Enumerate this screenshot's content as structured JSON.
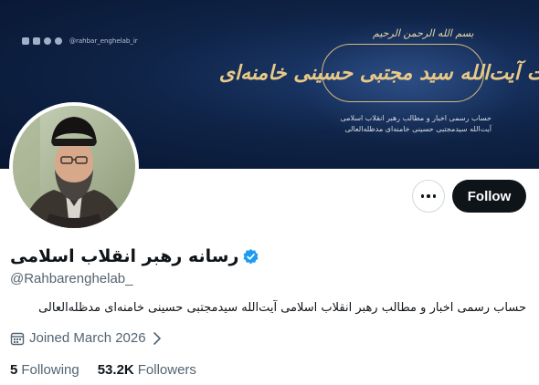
{
  "banner": {
    "social_handle": "@rahbar_enghelab_ir",
    "basmala": "بسم الله الرحمن الرحیم",
    "calligraphy": "حضرت آیت‌الله سید مجتبی حسینی خامنه‌ای",
    "line1": "حساب رسمی اخبار و مطالب رهبر انقلاب اسلامی",
    "line2": "آیت‌الله سیدمجتبی حسینی خامنه‌ای مدظله‌العالی"
  },
  "actions": {
    "more_icon": "more-horizontal-icon",
    "follow_label": "Follow"
  },
  "profile": {
    "display_name": "رسانه رهبر انقلاب اسلامی",
    "handle": "@Rahbarenghelab_",
    "bio": "حساب رسمی اخبار و مطالب رهبر انقلاب اسلامی آیت‌الله سیدمجتبی حسینی خامنه‌ای مدظله‌العالی",
    "joined": "Joined March 2026",
    "verified_color": "#1d9bf0"
  },
  "stats": {
    "following_count": "5",
    "following_label": "Following",
    "followers_count": "53.2K",
    "followers_label": "Followers"
  },
  "colors": {
    "primary_text": "#0f1419",
    "secondary_text": "#536471",
    "banner_bg": "#0f2448",
    "gold": "#d7b979"
  }
}
